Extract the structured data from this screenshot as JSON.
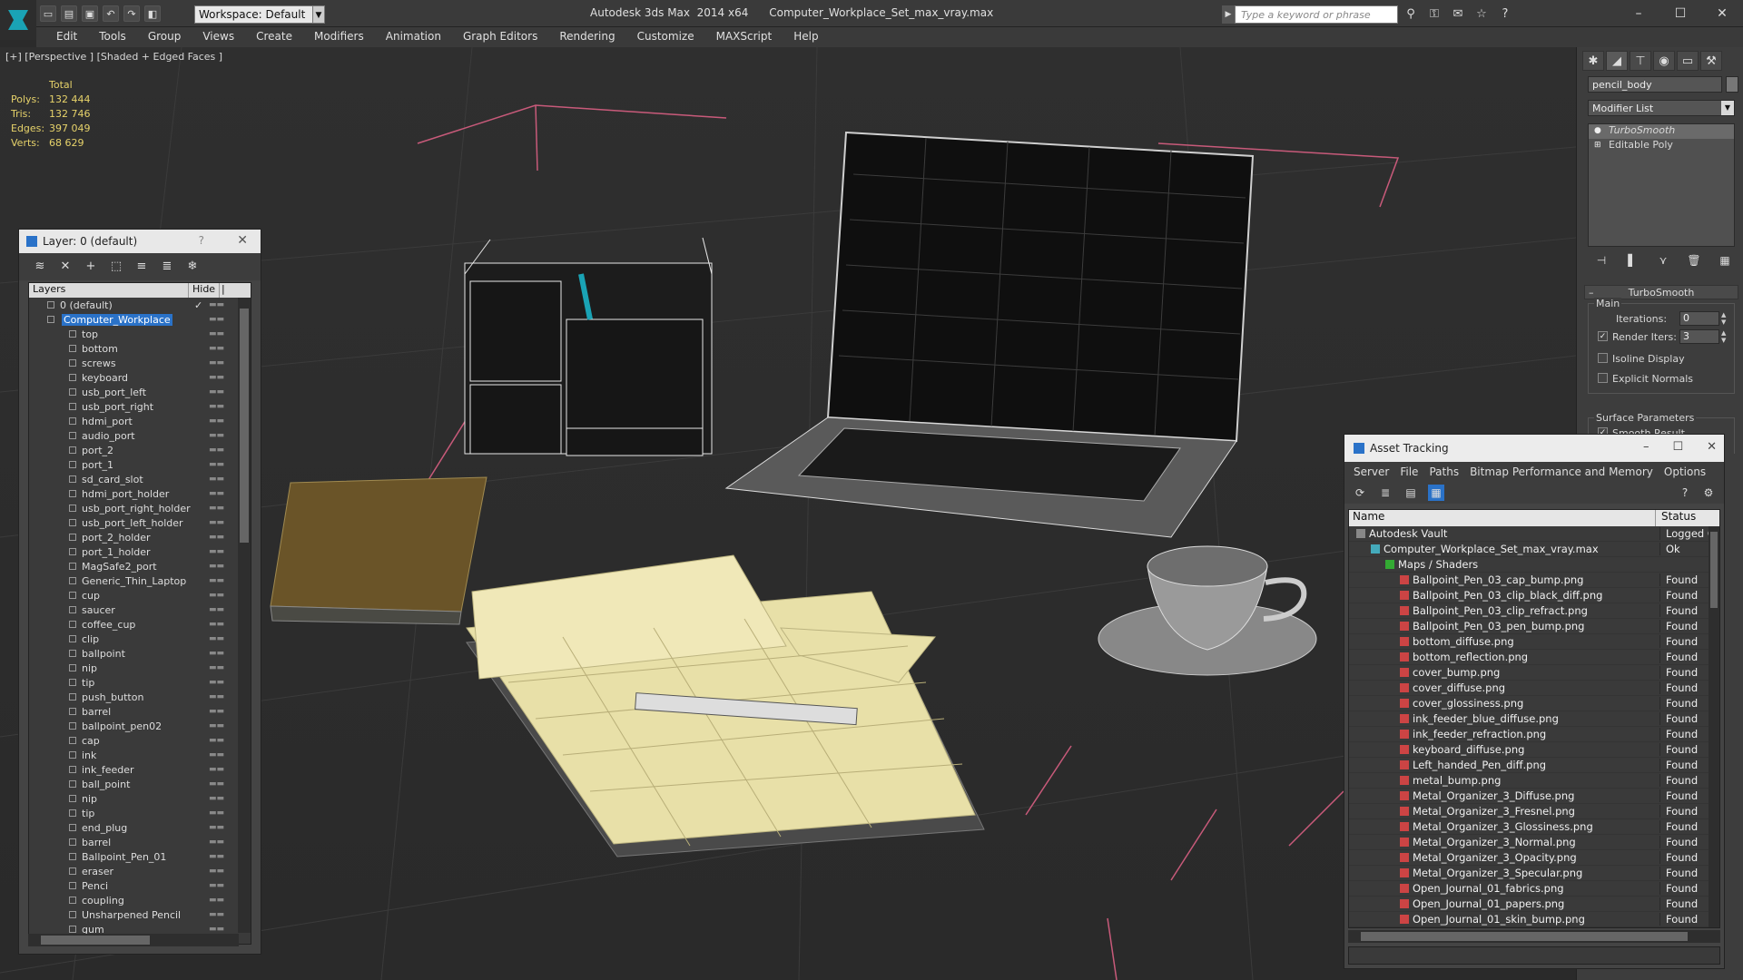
{
  "app": {
    "title": "Autodesk 3ds Max  2014 x64",
    "file": "Computer_Workplace_Set_max_vray.max",
    "workspace": "Workspace: Default",
    "search_placeholder": "Type a keyword or phrase"
  },
  "menu": [
    "Edit",
    "Tools",
    "Group",
    "Views",
    "Create",
    "Modifiers",
    "Animation",
    "Graph Editors",
    "Rendering",
    "Customize",
    "MAXScript",
    "Help"
  ],
  "viewport": {
    "label": "[+] [Perspective ] [Shaded + Edged Faces ]",
    "stats_header": "Total",
    "stats": [
      {
        "k": "Polys:",
        "v": "132 444"
      },
      {
        "k": "Tris:",
        "v": "132 746"
      },
      {
        "k": "Edges:",
        "v": "397 049"
      },
      {
        "k": "Verts:",
        "v": "68 629"
      }
    ]
  },
  "layer_panel": {
    "title": "Layer: 0 (default)",
    "help": "?",
    "col_layers": "Layers",
    "col_hide": "Hide",
    "col_extra": "|",
    "rows": [
      {
        "name": "0 (default)",
        "level": 0,
        "checked": true
      },
      {
        "name": "Computer_Workplace",
        "level": 1,
        "selected": true
      },
      {
        "name": "top",
        "level": 2
      },
      {
        "name": "bottom",
        "level": 2
      },
      {
        "name": "screws",
        "level": 2
      },
      {
        "name": "keyboard",
        "level": 2
      },
      {
        "name": "usb_port_left",
        "level": 2
      },
      {
        "name": "usb_port_right",
        "level": 2
      },
      {
        "name": "hdmi_port",
        "level": 2
      },
      {
        "name": "audio_port",
        "level": 2
      },
      {
        "name": "port_2",
        "level": 2
      },
      {
        "name": "port_1",
        "level": 2
      },
      {
        "name": "sd_card_slot",
        "level": 2
      },
      {
        "name": "hdmi_port_holder",
        "level": 2
      },
      {
        "name": "usb_port_right_holder",
        "level": 2
      },
      {
        "name": "usb_port_left_holder",
        "level": 2
      },
      {
        "name": "port_2_holder",
        "level": 2
      },
      {
        "name": "port_1_holder",
        "level": 2
      },
      {
        "name": "MagSafe2_port",
        "level": 2
      },
      {
        "name": "Generic_Thin_Laptop",
        "level": 2
      },
      {
        "name": "cup",
        "level": 2
      },
      {
        "name": "saucer",
        "level": 2
      },
      {
        "name": "coffee_cup",
        "level": 2
      },
      {
        "name": "clip",
        "level": 2
      },
      {
        "name": "ballpoint",
        "level": 2
      },
      {
        "name": "nip",
        "level": 2
      },
      {
        "name": "tip",
        "level": 2
      },
      {
        "name": "push_button",
        "level": 2
      },
      {
        "name": "barrel",
        "level": 2
      },
      {
        "name": "ballpoint_pen02",
        "level": 2
      },
      {
        "name": "cap",
        "level": 2
      },
      {
        "name": "ink",
        "level": 2
      },
      {
        "name": "ink_feeder",
        "level": 2
      },
      {
        "name": "ball_point",
        "level": 2
      },
      {
        "name": "nip",
        "level": 2
      },
      {
        "name": "tip",
        "level": 2
      },
      {
        "name": "end_plug",
        "level": 2
      },
      {
        "name": "barrel",
        "level": 2
      },
      {
        "name": "Ballpoint_Pen_01",
        "level": 2
      },
      {
        "name": "eraser",
        "level": 2
      },
      {
        "name": "Penci",
        "level": 2
      },
      {
        "name": "coupling",
        "level": 2
      },
      {
        "name": "Unsharpened Pencil",
        "level": 2
      },
      {
        "name": "gum",
        "level": 2
      }
    ]
  },
  "command_panel": {
    "object_name": "pencil_body",
    "modifier_list": "Modifier List",
    "stack": [
      "TurboSmooth",
      "Editable Poly"
    ],
    "rollout": "TurboSmooth",
    "main_group": "Main",
    "iterations_label": "Iterations:",
    "iterations_value": "0",
    "render_iters_label": "Render Iters:",
    "render_iters_value": "3",
    "isoline": "Isoline Display",
    "explicit_normals": "Explicit Normals",
    "surface_group": "Surface Parameters",
    "smooth_result": "Smooth Result"
  },
  "asset_tracking": {
    "title": "Asset Tracking",
    "menu": [
      "Server",
      "File",
      "Paths",
      "Bitmap Performance and Memory",
      "Options"
    ],
    "col_name": "Name",
    "col_status": "Status",
    "rows": [
      {
        "name": "Autodesk Vault",
        "status": "Logged O",
        "indent": 0,
        "icon": "vault"
      },
      {
        "name": "Computer_Workplace_Set_max_vray.max",
        "status": "Ok",
        "indent": 1,
        "icon": "max"
      },
      {
        "name": "Maps / Shaders",
        "status": "",
        "indent": 2,
        "icon": "maps"
      },
      {
        "name": "Ballpoint_Pen_03_cap_bump.png",
        "status": "Found",
        "indent": 3,
        "icon": "png"
      },
      {
        "name": "Ballpoint_Pen_03_clip_black_diff.png",
        "status": "Found",
        "indent": 3,
        "icon": "png"
      },
      {
        "name": "Ballpoint_Pen_03_clip_refract.png",
        "status": "Found",
        "indent": 3,
        "icon": "png"
      },
      {
        "name": "Ballpoint_Pen_03_pen_bump.png",
        "status": "Found",
        "indent": 3,
        "icon": "png"
      },
      {
        "name": "bottom_diffuse.png",
        "status": "Found",
        "indent": 3,
        "icon": "png"
      },
      {
        "name": "bottom_reflection.png",
        "status": "Found",
        "indent": 3,
        "icon": "png"
      },
      {
        "name": "cover_bump.png",
        "status": "Found",
        "indent": 3,
        "icon": "png"
      },
      {
        "name": "cover_diffuse.png",
        "status": "Found",
        "indent": 3,
        "icon": "png"
      },
      {
        "name": "cover_glossiness.png",
        "status": "Found",
        "indent": 3,
        "icon": "png"
      },
      {
        "name": "ink_feeder_blue_diffuse.png",
        "status": "Found",
        "indent": 3,
        "icon": "png"
      },
      {
        "name": "ink_feeder_refraction.png",
        "status": "Found",
        "indent": 3,
        "icon": "png"
      },
      {
        "name": "keyboard_diffuse.png",
        "status": "Found",
        "indent": 3,
        "icon": "png"
      },
      {
        "name": "Left_handed_Pen_diff.png",
        "status": "Found",
        "indent": 3,
        "icon": "png"
      },
      {
        "name": "metal_bump.png",
        "status": "Found",
        "indent": 3,
        "icon": "png"
      },
      {
        "name": "Metal_Organizer_3_Diffuse.png",
        "status": "Found",
        "indent": 3,
        "icon": "png"
      },
      {
        "name": "Metal_Organizer_3_Fresnel.png",
        "status": "Found",
        "indent": 3,
        "icon": "png"
      },
      {
        "name": "Metal_Organizer_3_Glossiness.png",
        "status": "Found",
        "indent": 3,
        "icon": "png"
      },
      {
        "name": "Metal_Organizer_3_Normal.png",
        "status": "Found",
        "indent": 3,
        "icon": "png"
      },
      {
        "name": "Metal_Organizer_3_Opacity.png",
        "status": "Found",
        "indent": 3,
        "icon": "png"
      },
      {
        "name": "Metal_Organizer_3_Specular.png",
        "status": "Found",
        "indent": 3,
        "icon": "png"
      },
      {
        "name": "Open_Journal_01_fabrics.png",
        "status": "Found",
        "indent": 3,
        "icon": "png"
      },
      {
        "name": "Open_Journal_01_papers.png",
        "status": "Found",
        "indent": 3,
        "icon": "png"
      },
      {
        "name": "Open_Journal_01_skin_bump.png",
        "status": "Found",
        "indent": 3,
        "icon": "png"
      }
    ]
  },
  "colors": {
    "selection": "#2a72c8",
    "stats_text": "#e6d26a",
    "wire_pink": "#d06080",
    "paper": "#e8e0a8"
  }
}
